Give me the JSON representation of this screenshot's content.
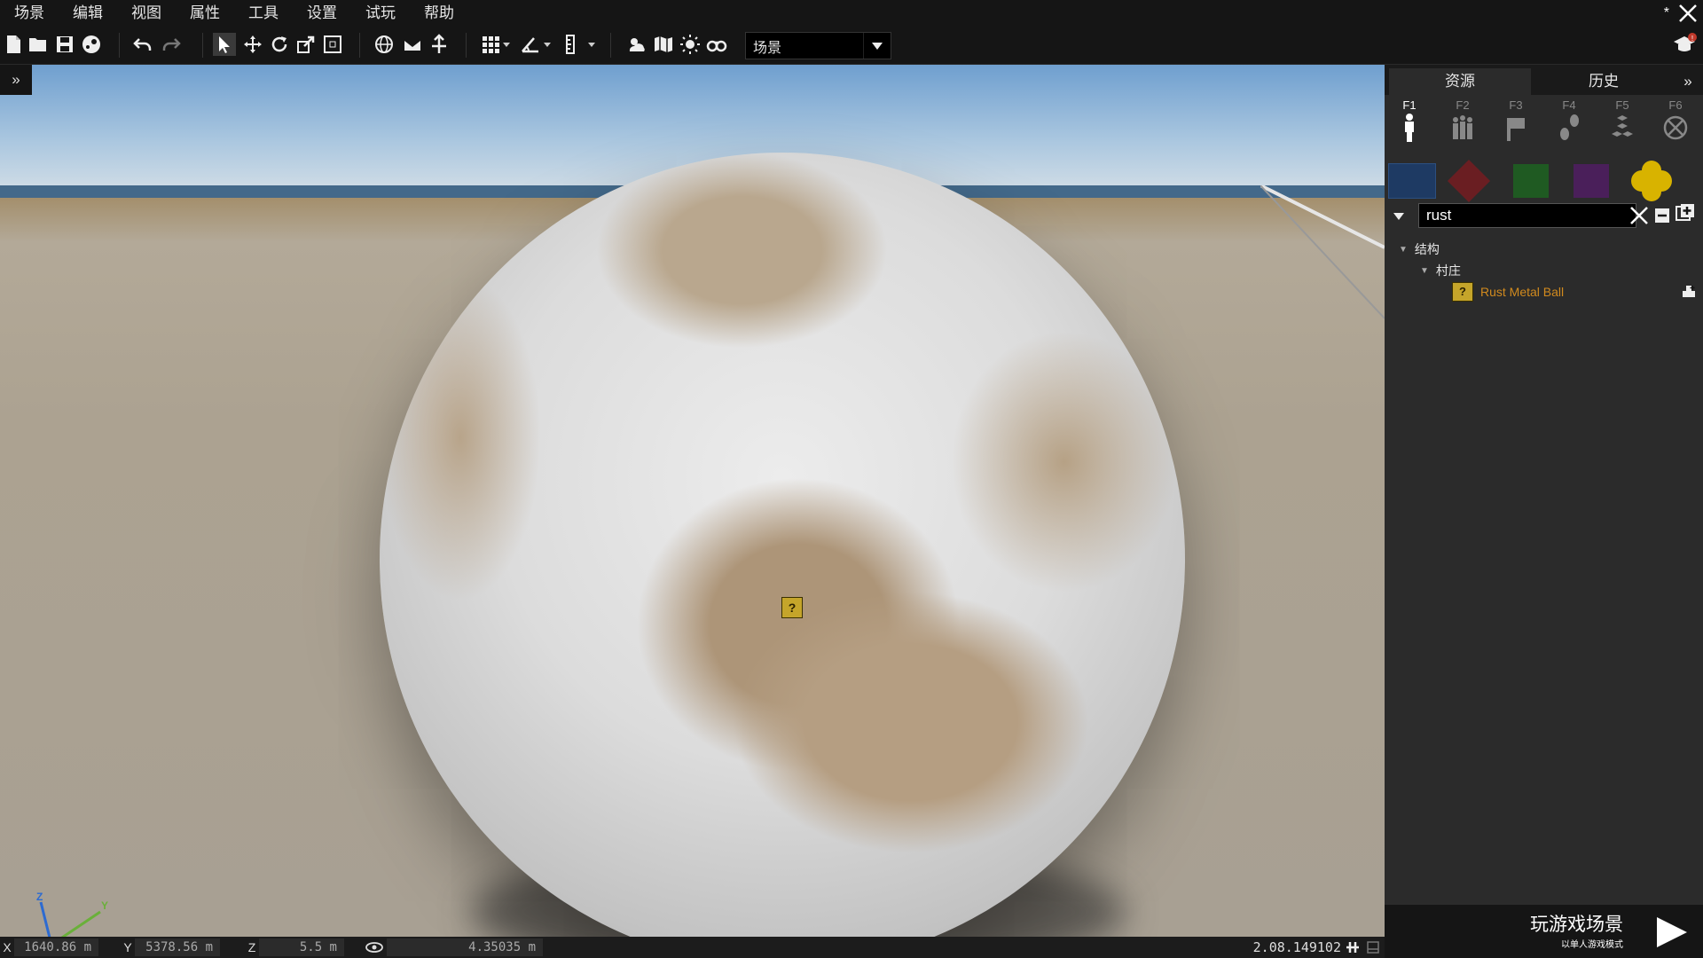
{
  "menu": [
    "场景",
    "编辑",
    "视图",
    "属性",
    "工具",
    "设置",
    "试玩",
    "帮助"
  ],
  "window": {
    "unsaved_marker": "*"
  },
  "toolbar": {
    "scene_select": {
      "value": "场景"
    }
  },
  "viewport": {
    "expand_label": "»",
    "object_marker": "?"
  },
  "panel": {
    "tabs": [
      {
        "label": "资源"
      },
      {
        "label": "历史"
      }
    ],
    "collapse_label": "»",
    "faction_tabs": [
      {
        "key": "F1",
        "icon": "single-unit-icon"
      },
      {
        "key": "F2",
        "icon": "group-icon"
      },
      {
        "key": "F3",
        "icon": "flag-marker-icon"
      },
      {
        "key": "F4",
        "icon": "waypoint-icon"
      },
      {
        "key": "F5",
        "icon": "modules-icon"
      },
      {
        "key": "F6",
        "icon": "empty-icon"
      }
    ],
    "sides": [
      {
        "name": "blufor",
        "color": "#1e3a63"
      },
      {
        "name": "opfor",
        "color": "#6a1e22"
      },
      {
        "name": "independent",
        "color": "#1f5a22"
      },
      {
        "name": "civilian",
        "color": "#4a1f5a"
      },
      {
        "name": "empty",
        "color": "#d8b300"
      }
    ],
    "search": {
      "value": "rust"
    },
    "tree": {
      "root": "结构",
      "group": "村庄",
      "result_icon": "?",
      "result": "Rust Metal Ball"
    }
  },
  "play": {
    "title": "玩游戏场景",
    "subtitle": "以单人游戏模式"
  },
  "status": {
    "x_label": "X",
    "x_value": "1640.86 m",
    "y_label": "Y",
    "y_value": "5378.56 m",
    "z_label": "Z",
    "z_value": "5.5 m",
    "dist_value": "4.35035 m",
    "version": "2.08.149102"
  }
}
